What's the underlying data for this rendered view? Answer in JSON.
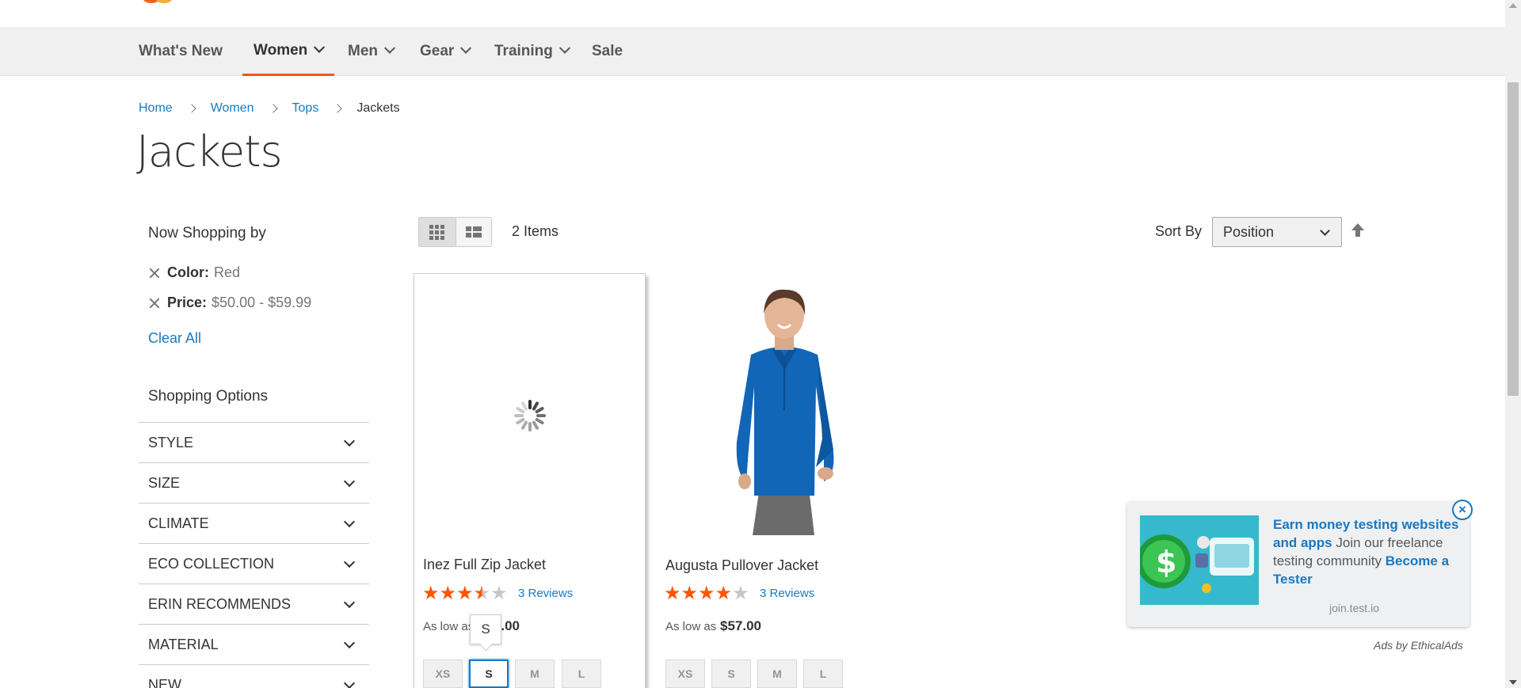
{
  "nav": {
    "items": [
      {
        "label": "What's New"
      },
      {
        "label": "Women"
      },
      {
        "label": "Men"
      },
      {
        "label": "Gear"
      },
      {
        "label": "Training"
      },
      {
        "label": "Sale"
      }
    ],
    "active": "Women"
  },
  "breadcrumb": [
    "Home",
    "Women",
    "Tops",
    "Jackets"
  ],
  "page_title": "Jackets",
  "sidebar": {
    "now_shopping_by": "Now Shopping by",
    "filters": [
      {
        "label": "Color:",
        "value": "Red"
      },
      {
        "label": "Price:",
        "value": "$50.00 - $59.99"
      }
    ],
    "clear_all": "Clear All",
    "shopping_options_title": "Shopping Options",
    "options": [
      "STYLE",
      "SIZE",
      "CLIMATE",
      "ECO COLLECTION",
      "ERIN RECOMMENDS",
      "MATERIAL",
      "NEW"
    ]
  },
  "toolbar": {
    "items_count": "2 Items",
    "sort_label": "Sort By",
    "sort_value": "Position",
    "view_mode": "grid"
  },
  "products": [
    {
      "name": "Inez Full Zip Jacket",
      "rating_fraction": 0.6,
      "reviews": "3 Reviews",
      "as_low_as": "As low as",
      "price": "$59.00",
      "sizes": [
        "XS",
        "S",
        "M",
        "L"
      ],
      "selected_size": "S",
      "tooltip": "S"
    },
    {
      "name": "Augusta Pullover Jacket",
      "rating_fraction": 0.8,
      "reviews": "3 Reviews",
      "as_low_as": "As low as",
      "price": "$57.00",
      "sizes": [
        "XS",
        "S",
        "M",
        "L"
      ]
    }
  ],
  "ad": {
    "headline": "Earn money testing websites and apps",
    "body": "Join our freelance testing community",
    "cta": "Become a Tester",
    "domain": "join.test.io",
    "credit": "Ads by EthicalAds",
    "close": "×"
  },
  "colors": {
    "accent": "#ff5501",
    "link": "#1979c3"
  }
}
